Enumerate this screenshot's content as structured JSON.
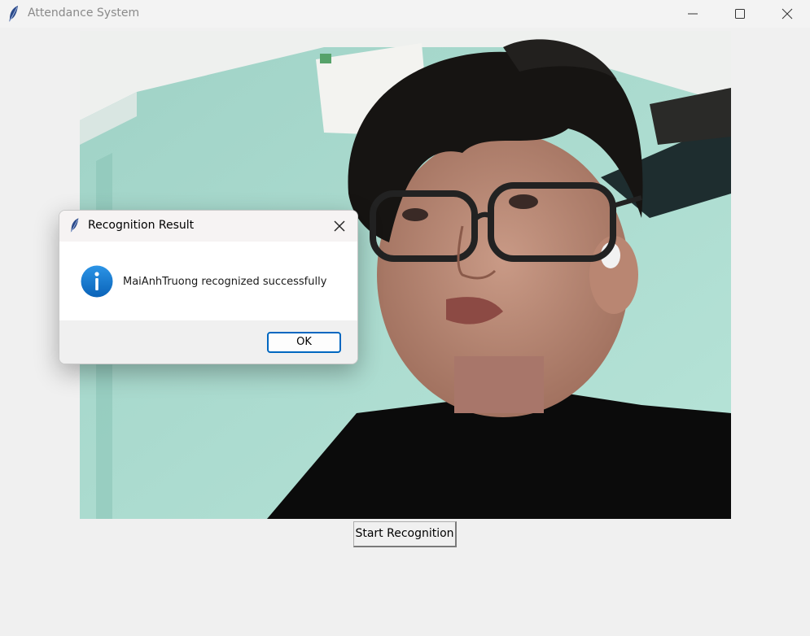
{
  "window": {
    "title": "Attendance System",
    "icons": {
      "app": "feather-icon",
      "minimize": "minimize-icon",
      "maximize": "maximize-icon",
      "close": "close-icon"
    }
  },
  "main": {
    "start_button_label": "Start Recognition"
  },
  "dialog": {
    "title": "Recognition Result",
    "message": "MaiAnhTruong recognized successfully",
    "ok_label": "OK",
    "icon": "info-icon",
    "accent_color": "#0067c0"
  }
}
